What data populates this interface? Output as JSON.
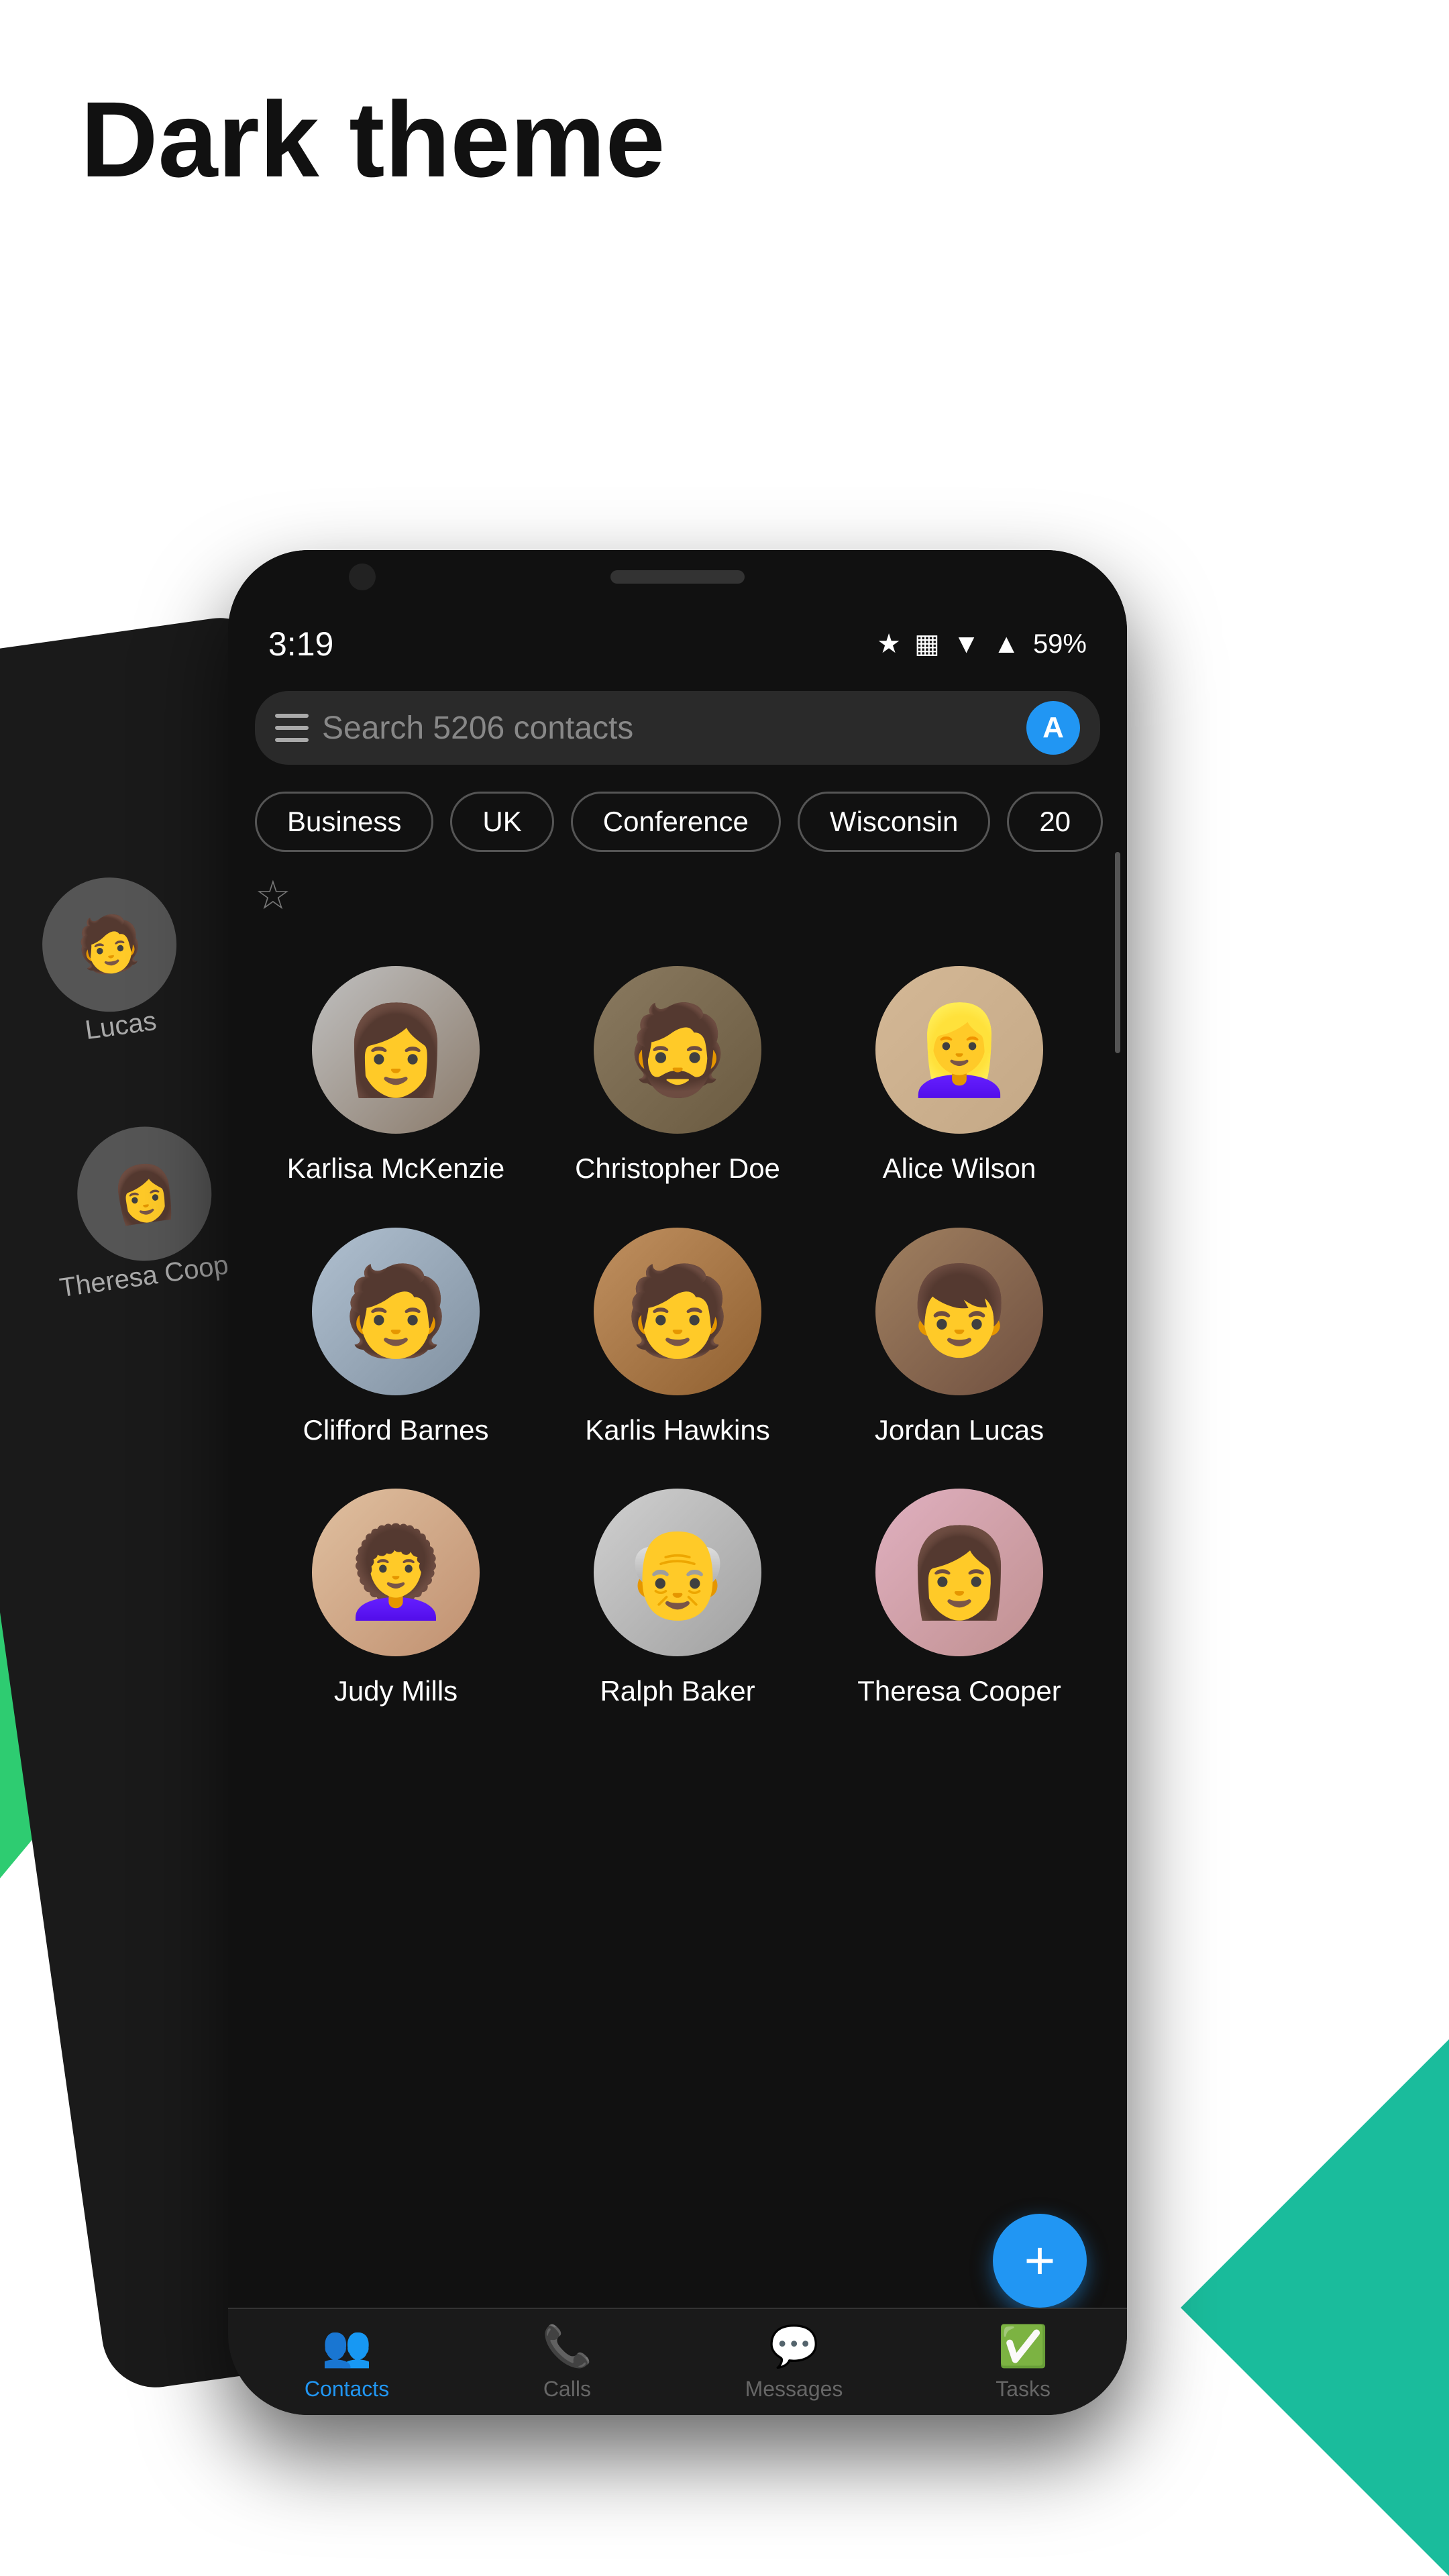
{
  "page": {
    "title": "Dark theme"
  },
  "status_bar": {
    "time": "3:19",
    "battery": "59%"
  },
  "search": {
    "placeholder": "Search 5206 contacts",
    "avatar_letter": "A"
  },
  "filter_chips": [
    {
      "label": "Business"
    },
    {
      "label": "UK"
    },
    {
      "label": "Conference"
    },
    {
      "label": "Wisconsin"
    },
    {
      "label": "20"
    }
  ],
  "contacts": [
    {
      "name": "Karlisa McKenzie",
      "avatar_class": "avatar-karlisa",
      "emoji": "👩"
    },
    {
      "name": "Christopher Doe",
      "avatar_class": "avatar-christopher",
      "emoji": "🧔"
    },
    {
      "name": "Alice Wilson",
      "avatar_class": "avatar-alice",
      "emoji": "👱‍♀️"
    },
    {
      "name": "Clifford Barnes",
      "avatar_class": "avatar-clifford",
      "emoji": "🧑"
    },
    {
      "name": "Karlis Hawkins",
      "avatar_class": "avatar-karlis",
      "emoji": "🧑"
    },
    {
      "name": "Jordan Lucas",
      "avatar_class": "avatar-jordan",
      "emoji": "👦"
    },
    {
      "name": "Judy Mills",
      "avatar_class": "avatar-judy",
      "emoji": "👩‍🦱"
    },
    {
      "name": "Ralph Baker",
      "avatar_class": "avatar-ralph",
      "emoji": "👴"
    },
    {
      "name": "Theresa Cooper",
      "avatar_class": "avatar-theresa",
      "emoji": "👩"
    }
  ],
  "bottom_nav": [
    {
      "label": "Contacts",
      "icon": "👥",
      "active": true
    },
    {
      "label": "Calls",
      "icon": "📞",
      "active": false
    },
    {
      "label": "Messages",
      "icon": "💬",
      "active": false
    },
    {
      "label": "Tasks",
      "icon": "✅",
      "active": false
    }
  ],
  "fab": {
    "label": "+"
  },
  "bg_phone": {
    "items": [
      {
        "name": "Lucas",
        "emoji": "🧑"
      },
      {
        "name": "Theresa Cooper",
        "emoji": "👩"
      }
    ]
  }
}
